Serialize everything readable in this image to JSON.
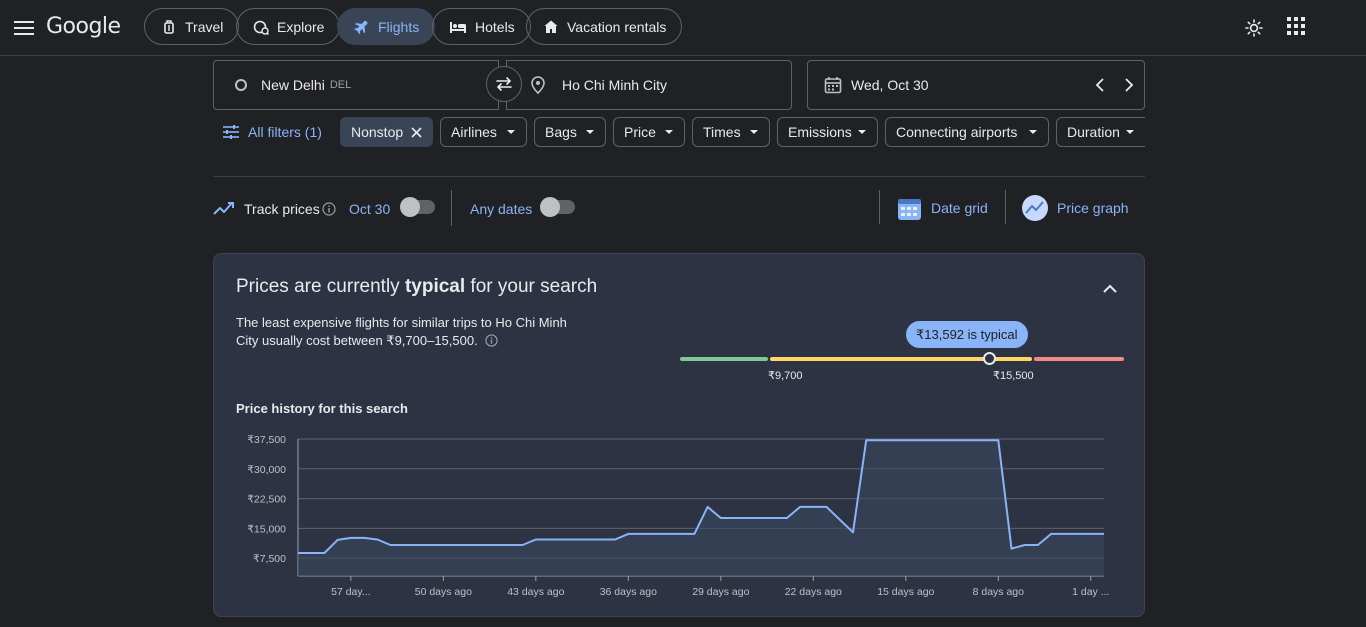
{
  "brand": {
    "logo_text": "Google"
  },
  "nav": {
    "tabs": [
      {
        "label": "Travel",
        "icon": "luggage-icon",
        "active": false
      },
      {
        "label": "Explore",
        "icon": "explore-icon",
        "active": false
      },
      {
        "label": "Flights",
        "icon": "airplane-icon",
        "active": true
      },
      {
        "label": "Hotels",
        "icon": "bed-icon",
        "active": false
      },
      {
        "label": "Vacation rentals",
        "icon": "house-icon",
        "active": false
      }
    ]
  },
  "search": {
    "origin": {
      "city": "New Delhi",
      "code": "DEL"
    },
    "destination": {
      "city": "Ho Chi Minh City"
    },
    "date": "Wed, Oct 30"
  },
  "filters": {
    "all_filters_label": "All filters (1)",
    "nonstop_label": "Nonstop",
    "chips": [
      "Airlines",
      "Bags",
      "Price",
      "Times",
      "Emissions",
      "Connecting airports",
      "Duration"
    ]
  },
  "tracking": {
    "track_label": "Track prices",
    "date_label": "Oct 30",
    "any_dates_label": "Any dates",
    "track_on": false,
    "any_dates_on": false,
    "date_grid_label": "Date grid",
    "price_graph_label": "Price graph"
  },
  "insights": {
    "title_prefix": "Prices are currently ",
    "title_bold": "typical",
    "title_suffix": " for your search",
    "description": "The least expensive flights for similar trips to Ho Chi Minh City usually cost between ₹9,700–15,500.",
    "typical_badge": "₹13,592 is typical",
    "typical_value": 13592,
    "range_low_label": "₹9,700",
    "range_high_label": "₹15,500",
    "colors": {
      "low": "#81c995",
      "typical": "#fdd663",
      "high": "#f28b82",
      "line": "#8ab4f8"
    }
  },
  "history": {
    "title": "Price history for this search"
  },
  "chart_data": {
    "type": "area",
    "ylim": [
      3000,
      37500
    ],
    "y_ticks": [
      7500,
      15000,
      22500,
      30000,
      37500
    ],
    "y_tick_labels": [
      "₹7,500",
      "₹15,000",
      "₹22,500",
      "₹30,000",
      "₹37,500"
    ],
    "x_ticks": [
      57,
      50,
      43,
      36,
      29,
      22,
      15,
      8,
      1
    ],
    "x_tick_labels": [
      "57 day...",
      "50 days ago",
      "43 days ago",
      "36 days ago",
      "29 days ago",
      "22 days ago",
      "15 days ago",
      "8 days ago",
      "1 day ..."
    ],
    "xlim": [
      61,
      0
    ],
    "x_unit": "days ago",
    "series": [
      {
        "x": [
          61,
          59,
          58,
          57,
          56,
          55,
          54,
          53,
          50,
          45,
          44,
          43,
          42,
          37,
          36,
          35,
          31,
          30,
          29,
          28,
          24,
          23,
          22,
          21,
          19,
          18,
          17,
          16,
          13,
          8,
          7,
          6,
          5,
          4,
          3,
          2,
          1,
          0
        ],
        "y": [
          8800,
          8800,
          12100,
          12600,
          12600,
          12200,
          10800,
          10800,
          10800,
          10800,
          10800,
          12200,
          12200,
          12200,
          13600,
          13600,
          13600,
          20400,
          17600,
          17600,
          17600,
          20400,
          20400,
          20400,
          14000,
          37200,
          37200,
          37200,
          37200,
          37200,
          9900,
          10800,
          10800,
          13600,
          13600,
          13600,
          13600,
          13600
        ]
      }
    ],
    "grid": true,
    "legend": "none"
  }
}
